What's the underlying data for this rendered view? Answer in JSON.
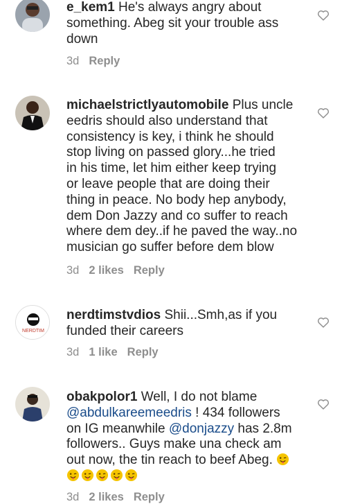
{
  "comments": [
    {
      "username": "e_kem1",
      "text": "He's always angry about\nsomething. Abeg sit your trouble ass\ndown",
      "time": "3d",
      "likes": "",
      "reply": "Reply"
    },
    {
      "username": "michaelstrictlyautomobile",
      "text": "Plus uncle\needris should also understand that\nconsistency is key, i think he should\nstop living on passed glory...he tried\nin his time, let him either keep trying\nor leave people that are doing their\nthing in peace. No body hep anybody,\ndem Don Jazzy and co suffer to reach\nwhere dem dey..if he paved the way..no\nmusician go suffer before dem blow",
      "time": "3d",
      "likes": "2 likes",
      "reply": "Reply"
    },
    {
      "username": "nerdtimstvdios",
      "text": "Shii...Smh,as if you\nfunded their careers",
      "time": "3d",
      "likes": "1 like",
      "reply": "Reply",
      "avatar_text": "NERDTIM"
    },
    {
      "username": "obakpolor1",
      "text_before": "Well, I do not blame",
      "mention1": "@abdulkareemeedris",
      "text_mid1": " ! 434 followers\non IG meanwhile ",
      "mention2": "@donjazzy",
      "text_mid2": " has 2.8m\nfollowers.. Guys make una check am\nout now, the tin reach to beef Abeg. ",
      "time": "3d",
      "likes": "2 likes",
      "reply": "Reply"
    }
  ],
  "colors": {
    "text": "#262626",
    "meta": "#8e8e8e",
    "mention": "#1a4c8a",
    "heart": "#8e8e8e",
    "emoji": "#f5c400"
  },
  "icons": {
    "like": "heart-outline-icon",
    "emoji": "winking-tongue-emoji-icon"
  }
}
